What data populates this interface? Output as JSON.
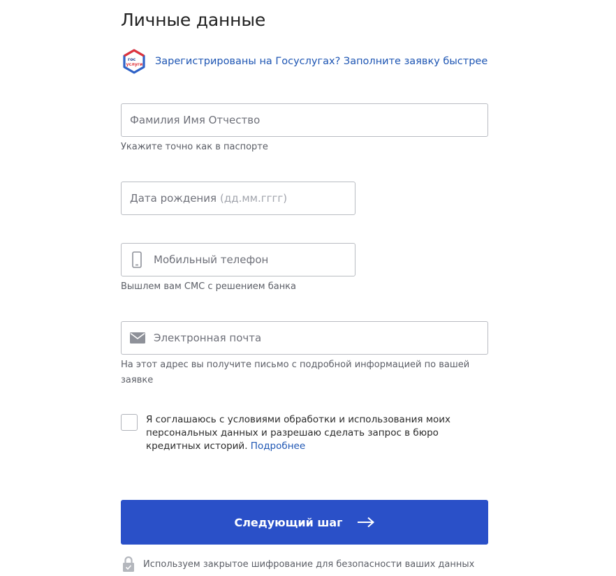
{
  "page": {
    "title": "Личные данные"
  },
  "gosuslugi": {
    "logo_text_top": "гос",
    "logo_text_bottom": "услуги",
    "link_label": "Зарегистрированы на Госуслугах? Заполните заявку быстрее",
    "icon": "gosuslugi-logo"
  },
  "form": {
    "full_name": {
      "placeholder": "Фамилия Имя Отчество",
      "value": "",
      "hint": "Укажите точно как в паспорте"
    },
    "birth_date": {
      "placeholder": "Дата рождения",
      "format_hint": "(дд.мм.гггг)",
      "value": ""
    },
    "phone": {
      "placeholder": "Мобильный телефон",
      "value": "",
      "hint": "Вышлем вам СМС с решением банка",
      "icon": "phone-icon"
    },
    "email": {
      "placeholder": "Электронная почта",
      "value": "",
      "hint": "На этот адрес вы получите письмо с подробной информацией по вашей заявке",
      "icon": "mail-icon"
    },
    "consent": {
      "checked": false,
      "text": "Я соглашаюсь с условиями обработки и использования моих персональных данных и разрешаю сделать запрос в бюро кредитных историй.",
      "link_label": "Подробнее"
    },
    "next_button": {
      "label": "Следующий шаг",
      "icon": "arrow-right-icon"
    },
    "security_note": {
      "text": "Используем закрытое шифрование для безопасности ваших данных",
      "icon": "lock-icon"
    }
  },
  "colors": {
    "accent": "#2a50c8",
    "link": "#1d55b3",
    "border": "#b9bcc2",
    "hint_text": "#5b5e66"
  }
}
